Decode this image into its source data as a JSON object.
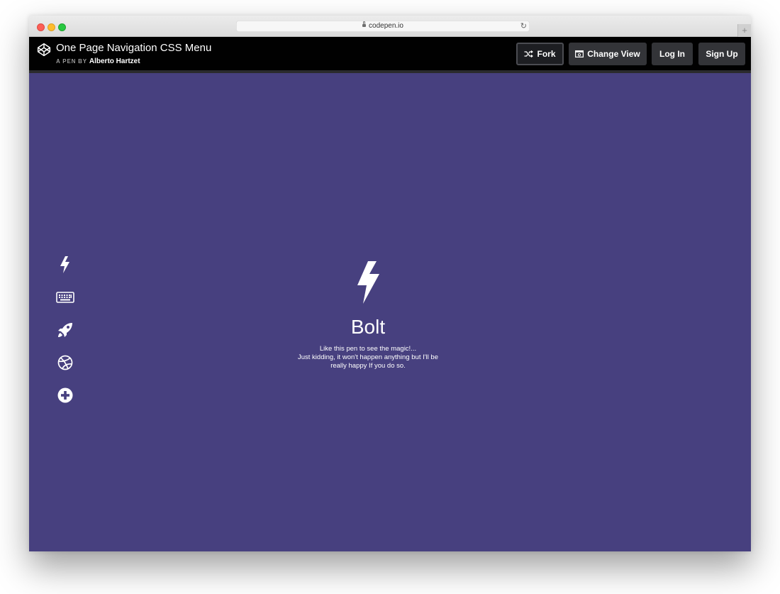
{
  "browser": {
    "url": "codepen.io"
  },
  "header": {
    "pen_title": "One Page Navigation CSS Menu",
    "by_label": "A PEN BY",
    "author": "Alberto Hartzet",
    "buttons": {
      "fork": "Fork",
      "change_view": "Change View",
      "login": "Log In",
      "signup": "Sign Up"
    }
  },
  "pen": {
    "background_color": "#47407f",
    "nav_icons": [
      "bolt-icon",
      "keyboard-icon",
      "rocket-icon",
      "dribbble-icon",
      "plus-circle-icon"
    ],
    "active_section": {
      "icon": "bolt-icon",
      "title": "Bolt",
      "lines": [
        "Like this pen to see the magic!...",
        "Just kidding, it won't happen anything but I'll be",
        "really happy If you do so."
      ]
    }
  }
}
